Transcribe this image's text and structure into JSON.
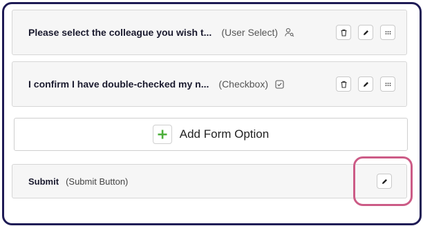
{
  "questions": [
    {
      "label": "Please select the colleague you wish t...",
      "type": "(User Select)",
      "type_icon": "user-search-icon"
    },
    {
      "label": "I confirm I have double-checked my n...",
      "type": "(Checkbox)",
      "type_icon": "checkbox-icon"
    }
  ],
  "actions": {
    "delete_icon": "trash-icon",
    "edit_icon": "pencil-icon",
    "drag_icon": "grip-icon"
  },
  "add_option": {
    "label": "Add Form Option",
    "icon": "plus-icon"
  },
  "submit": {
    "label": "Submit",
    "type": "(Submit Button)",
    "edit_icon": "pencil-icon"
  },
  "colors": {
    "frame_border": "#1e1b55",
    "highlight": "#cc5b86",
    "plus": "#4caf3a"
  }
}
